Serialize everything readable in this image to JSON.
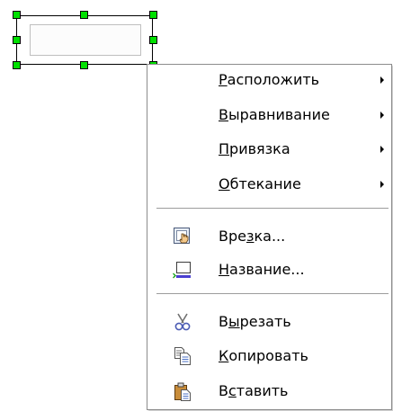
{
  "context_menu": {
    "items": [
      {
        "label_pre": "",
        "label_accel": "Р",
        "label_post": "асположить",
        "has_submenu": true,
        "icon": ""
      },
      {
        "label_pre": "",
        "label_accel": "В",
        "label_post": "ыравнивание",
        "has_submenu": true,
        "icon": ""
      },
      {
        "label_pre": "",
        "label_accel": "П",
        "label_post": "ривязка",
        "has_submenu": true,
        "icon": ""
      },
      {
        "label_pre": "",
        "label_accel": "О",
        "label_post": "бтекание",
        "has_submenu": true,
        "icon": ""
      },
      {
        "label_pre": "Вре",
        "label_accel": "з",
        "label_post": "ка...",
        "has_submenu": false,
        "icon": "frame-hand-icon"
      },
      {
        "label_pre": "",
        "label_accel": "Н",
        "label_post": "азвание...",
        "has_submenu": false,
        "icon": "caption-icon"
      },
      {
        "label_pre": "В",
        "label_accel": "ы",
        "label_post": "резать",
        "has_submenu": false,
        "icon": "scissors-icon"
      },
      {
        "label_pre": "",
        "label_accel": "К",
        "label_post": "опировать",
        "has_submenu": false,
        "icon": "copy-icon"
      },
      {
        "label_pre": "В",
        "label_accel": "с",
        "label_post": "тавить",
        "has_submenu": false,
        "icon": "paste-icon"
      }
    ]
  },
  "colors": {
    "handle": "#00e000",
    "menu_border": "#8c8c8c",
    "separator": "#9c9c9c"
  }
}
